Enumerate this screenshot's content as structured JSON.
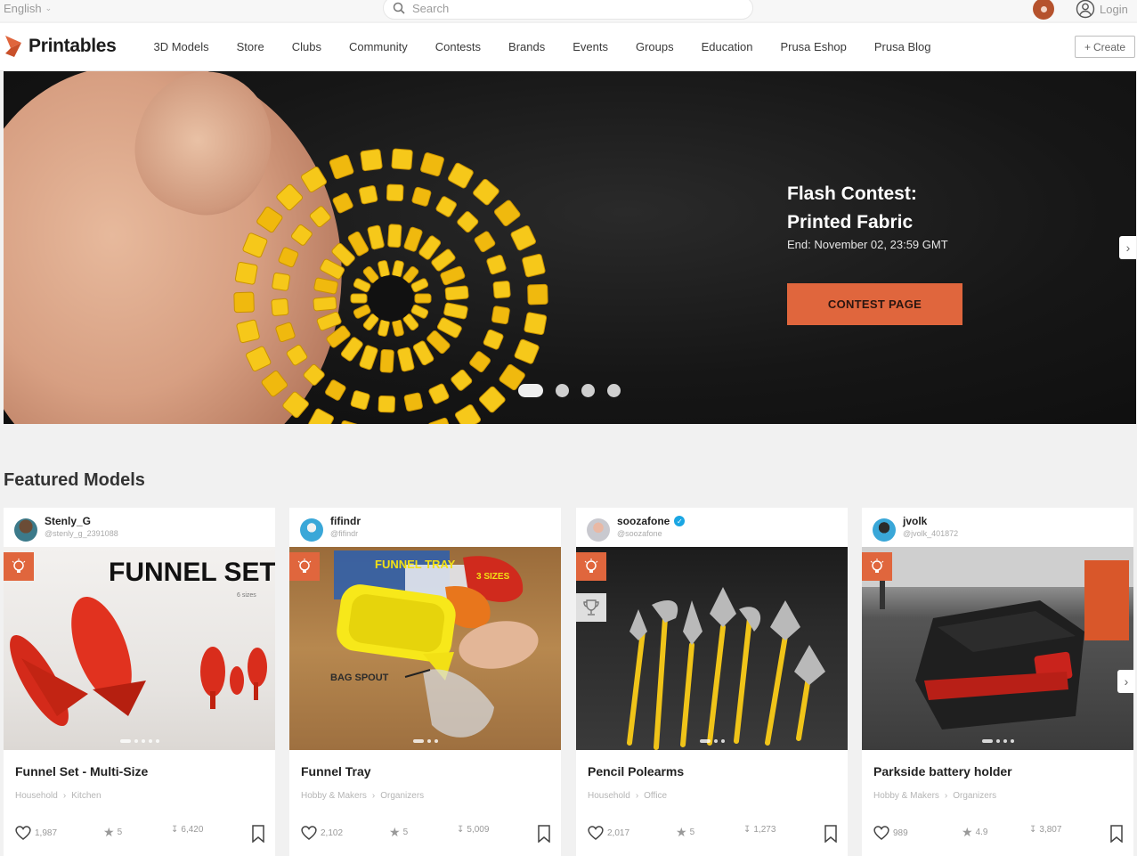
{
  "topbar": {
    "language": "English",
    "search_placeholder": "Search",
    "login_label": "Login"
  },
  "nav": {
    "logo": "Printables",
    "links": [
      "3D Models",
      "Store",
      "Clubs",
      "Community",
      "Contests",
      "Brands",
      "Events",
      "Groups",
      "Education",
      "Prusa Eshop",
      "Prusa Blog"
    ],
    "create_label": "Create"
  },
  "hero": {
    "title_line1": "Flash Contest:",
    "title_line2": "Printed Fabric",
    "subtitle": "End: November 02, 23:59 GMT",
    "cta": "CONTEST PAGE",
    "slide_count": 4,
    "active_slide": 1
  },
  "featured": {
    "heading": "Featured Models",
    "cards": [
      {
        "user": "Stenly_G",
        "handle": "@stenly_g_2391088",
        "verified": false,
        "title": "Funnel Set - Multi-Size",
        "categories": [
          "Household",
          "Kitchen"
        ],
        "likes": "1,987",
        "rating": "5",
        "downloads": "6,420",
        "image_text": "FUNNEL SET",
        "image_caption": "6 sizes",
        "contest_winner": false
      },
      {
        "user": "fifindr",
        "handle": "@fifindr",
        "verified": false,
        "title": "Funnel Tray",
        "categories": [
          "Hobby & Makers",
          "Organizers"
        ],
        "likes": "2,102",
        "rating": "5",
        "downloads": "5,009",
        "image_text": "FUNNEL TRAY",
        "image_caption": "3 SIZES",
        "image_note": "BAG SPOUT",
        "contest_winner": false
      },
      {
        "user": "soozafone",
        "handle": "@soozafone",
        "verified": true,
        "title": "Pencil Polearms",
        "categories": [
          "Household",
          "Office"
        ],
        "likes": "2,017",
        "rating": "5",
        "downloads": "1,273",
        "contest_winner": true
      },
      {
        "user": "jvolk",
        "handle": "@jvolk_401872",
        "verified": false,
        "title": "Parkside battery holder",
        "categories": [
          "Hobby & Makers",
          "Organizers"
        ],
        "likes": "989",
        "rating": "4.9",
        "downloads": "3,807",
        "contest_winner": false
      }
    ]
  },
  "colors": {
    "accent": "#e0663d",
    "page_bg": "#f1f1f1",
    "hero_bg": "#141414"
  },
  "icons": {
    "search": "search-icon",
    "login": "user-circle-icon",
    "create": "plus-icon",
    "badge": "lightbulb-icon",
    "trophy": "trophy-icon",
    "like": "heart-icon",
    "rating": "star-icon",
    "downloads": "download-icon",
    "save": "bookmark-icon",
    "next": "chevron-right-icon"
  }
}
